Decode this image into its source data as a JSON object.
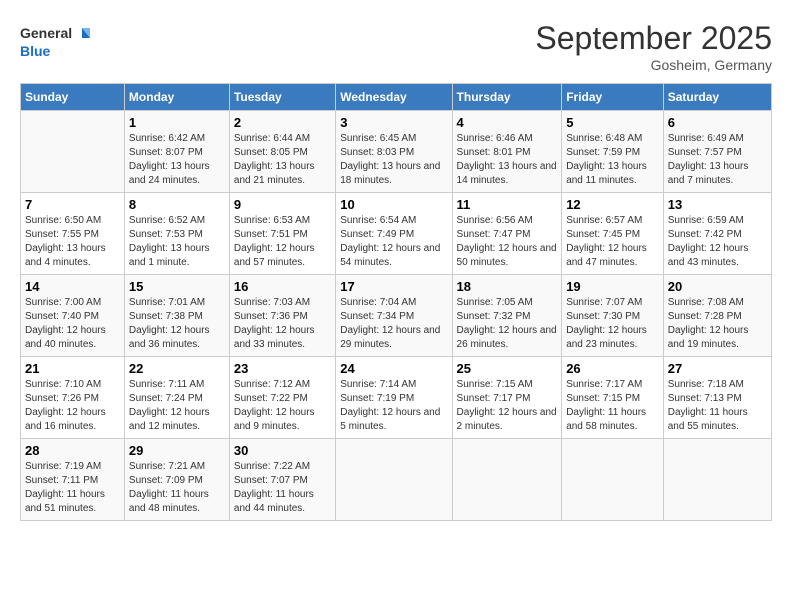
{
  "logo": {
    "general": "General",
    "blue": "Blue"
  },
  "title": "September 2025",
  "location": "Gosheim, Germany",
  "days_of_week": [
    "Sunday",
    "Monday",
    "Tuesday",
    "Wednesday",
    "Thursday",
    "Friday",
    "Saturday"
  ],
  "weeks": [
    [
      {
        "day": "",
        "sunrise": "",
        "sunset": "",
        "daylight": ""
      },
      {
        "day": "1",
        "sunrise": "Sunrise: 6:42 AM",
        "sunset": "Sunset: 8:07 PM",
        "daylight": "Daylight: 13 hours and 24 minutes."
      },
      {
        "day": "2",
        "sunrise": "Sunrise: 6:44 AM",
        "sunset": "Sunset: 8:05 PM",
        "daylight": "Daylight: 13 hours and 21 minutes."
      },
      {
        "day": "3",
        "sunrise": "Sunrise: 6:45 AM",
        "sunset": "Sunset: 8:03 PM",
        "daylight": "Daylight: 13 hours and 18 minutes."
      },
      {
        "day": "4",
        "sunrise": "Sunrise: 6:46 AM",
        "sunset": "Sunset: 8:01 PM",
        "daylight": "Daylight: 13 hours and 14 minutes."
      },
      {
        "day": "5",
        "sunrise": "Sunrise: 6:48 AM",
        "sunset": "Sunset: 7:59 PM",
        "daylight": "Daylight: 13 hours and 11 minutes."
      },
      {
        "day": "6",
        "sunrise": "Sunrise: 6:49 AM",
        "sunset": "Sunset: 7:57 PM",
        "daylight": "Daylight: 13 hours and 7 minutes."
      }
    ],
    [
      {
        "day": "7",
        "sunrise": "Sunrise: 6:50 AM",
        "sunset": "Sunset: 7:55 PM",
        "daylight": "Daylight: 13 hours and 4 minutes."
      },
      {
        "day": "8",
        "sunrise": "Sunrise: 6:52 AM",
        "sunset": "Sunset: 7:53 PM",
        "daylight": "Daylight: 13 hours and 1 minute."
      },
      {
        "day": "9",
        "sunrise": "Sunrise: 6:53 AM",
        "sunset": "Sunset: 7:51 PM",
        "daylight": "Daylight: 12 hours and 57 minutes."
      },
      {
        "day": "10",
        "sunrise": "Sunrise: 6:54 AM",
        "sunset": "Sunset: 7:49 PM",
        "daylight": "Daylight: 12 hours and 54 minutes."
      },
      {
        "day": "11",
        "sunrise": "Sunrise: 6:56 AM",
        "sunset": "Sunset: 7:47 PM",
        "daylight": "Daylight: 12 hours and 50 minutes."
      },
      {
        "day": "12",
        "sunrise": "Sunrise: 6:57 AM",
        "sunset": "Sunset: 7:45 PM",
        "daylight": "Daylight: 12 hours and 47 minutes."
      },
      {
        "day": "13",
        "sunrise": "Sunrise: 6:59 AM",
        "sunset": "Sunset: 7:42 PM",
        "daylight": "Daylight: 12 hours and 43 minutes."
      }
    ],
    [
      {
        "day": "14",
        "sunrise": "Sunrise: 7:00 AM",
        "sunset": "Sunset: 7:40 PM",
        "daylight": "Daylight: 12 hours and 40 minutes."
      },
      {
        "day": "15",
        "sunrise": "Sunrise: 7:01 AM",
        "sunset": "Sunset: 7:38 PM",
        "daylight": "Daylight: 12 hours and 36 minutes."
      },
      {
        "day": "16",
        "sunrise": "Sunrise: 7:03 AM",
        "sunset": "Sunset: 7:36 PM",
        "daylight": "Daylight: 12 hours and 33 minutes."
      },
      {
        "day": "17",
        "sunrise": "Sunrise: 7:04 AM",
        "sunset": "Sunset: 7:34 PM",
        "daylight": "Daylight: 12 hours and 29 minutes."
      },
      {
        "day": "18",
        "sunrise": "Sunrise: 7:05 AM",
        "sunset": "Sunset: 7:32 PM",
        "daylight": "Daylight: 12 hours and 26 minutes."
      },
      {
        "day": "19",
        "sunrise": "Sunrise: 7:07 AM",
        "sunset": "Sunset: 7:30 PM",
        "daylight": "Daylight: 12 hours and 23 minutes."
      },
      {
        "day": "20",
        "sunrise": "Sunrise: 7:08 AM",
        "sunset": "Sunset: 7:28 PM",
        "daylight": "Daylight: 12 hours and 19 minutes."
      }
    ],
    [
      {
        "day": "21",
        "sunrise": "Sunrise: 7:10 AM",
        "sunset": "Sunset: 7:26 PM",
        "daylight": "Daylight: 12 hours and 16 minutes."
      },
      {
        "day": "22",
        "sunrise": "Sunrise: 7:11 AM",
        "sunset": "Sunset: 7:24 PM",
        "daylight": "Daylight: 12 hours and 12 minutes."
      },
      {
        "day": "23",
        "sunrise": "Sunrise: 7:12 AM",
        "sunset": "Sunset: 7:22 PM",
        "daylight": "Daylight: 12 hours and 9 minutes."
      },
      {
        "day": "24",
        "sunrise": "Sunrise: 7:14 AM",
        "sunset": "Sunset: 7:19 PM",
        "daylight": "Daylight: 12 hours and 5 minutes."
      },
      {
        "day": "25",
        "sunrise": "Sunrise: 7:15 AM",
        "sunset": "Sunset: 7:17 PM",
        "daylight": "Daylight: 12 hours and 2 minutes."
      },
      {
        "day": "26",
        "sunrise": "Sunrise: 7:17 AM",
        "sunset": "Sunset: 7:15 PM",
        "daylight": "Daylight: 11 hours and 58 minutes."
      },
      {
        "day": "27",
        "sunrise": "Sunrise: 7:18 AM",
        "sunset": "Sunset: 7:13 PM",
        "daylight": "Daylight: 11 hours and 55 minutes."
      }
    ],
    [
      {
        "day": "28",
        "sunrise": "Sunrise: 7:19 AM",
        "sunset": "Sunset: 7:11 PM",
        "daylight": "Daylight: 11 hours and 51 minutes."
      },
      {
        "day": "29",
        "sunrise": "Sunrise: 7:21 AM",
        "sunset": "Sunset: 7:09 PM",
        "daylight": "Daylight: 11 hours and 48 minutes."
      },
      {
        "day": "30",
        "sunrise": "Sunrise: 7:22 AM",
        "sunset": "Sunset: 7:07 PM",
        "daylight": "Daylight: 11 hours and 44 minutes."
      },
      {
        "day": "",
        "sunrise": "",
        "sunset": "",
        "daylight": ""
      },
      {
        "day": "",
        "sunrise": "",
        "sunset": "",
        "daylight": ""
      },
      {
        "day": "",
        "sunrise": "",
        "sunset": "",
        "daylight": ""
      },
      {
        "day": "",
        "sunrise": "",
        "sunset": "",
        "daylight": ""
      }
    ]
  ]
}
